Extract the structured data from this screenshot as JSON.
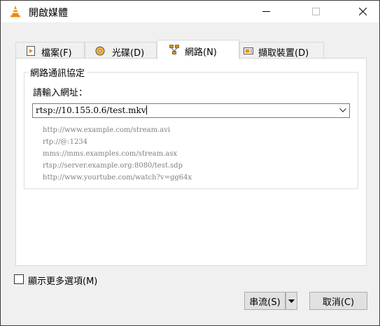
{
  "window": {
    "title": "開啟媒體",
    "icon": "vlc-cone-icon"
  },
  "tabs": [
    {
      "label": "檔案(F)",
      "icon": "file-play-icon"
    },
    {
      "label": "光碟(D)",
      "icon": "disc-icon"
    },
    {
      "label": "網路(N)",
      "icon": "network-icon",
      "active": true
    },
    {
      "label": "擷取裝置(D)",
      "icon": "capture-card-icon"
    }
  ],
  "network": {
    "group_title": "網路通訊協定",
    "url_prompt": "請輸入網址：",
    "url_value": "rtsp://10.155.0.6/test.mkv",
    "examples": [
      "http://www.example.com/stream.avi",
      "rtp://@:1234",
      "mms://mms.examples.com/stream.asx",
      "rtsp://server.example.org:8080/test.sdp",
      "http://www.yourtube.com/watch?v=gg64x"
    ]
  },
  "options": {
    "show_more_label": "顯示更多選項(M)",
    "show_more_checked": false
  },
  "buttons": {
    "stream": "串流(S)",
    "cancel": "取消(C)"
  },
  "colors": {
    "accent_orange": "#f08c00",
    "example_text": "#808080",
    "panel_bg": "#ffffff",
    "window_bg": "#f0f0f0"
  }
}
